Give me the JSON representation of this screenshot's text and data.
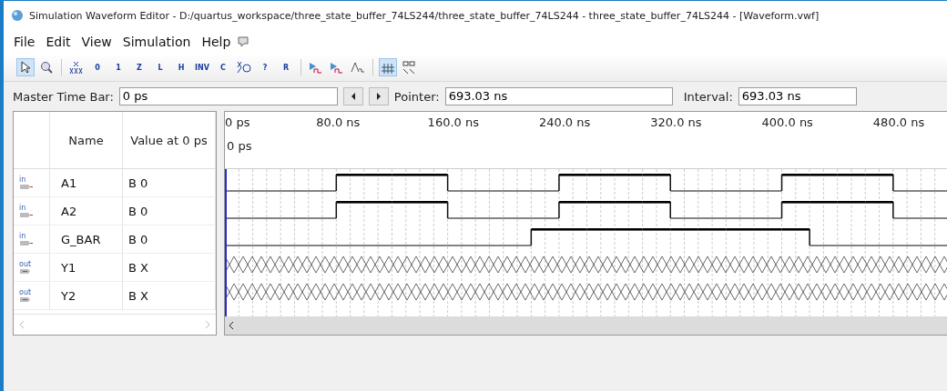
{
  "window": {
    "title": "Simulation Waveform Editor - D:/quartus_workspace/three_state_buffer_74LS244/three_state_buffer_74LS244 - three_state_buffer_74LS244 - [Waveform.vwf]"
  },
  "menu": [
    "File",
    "Edit",
    "View",
    "Simulation",
    "Help"
  ],
  "toolbar": [
    {
      "kind": "pointer",
      "selected": true
    },
    {
      "kind": "zoom",
      "selected": false
    },
    {
      "kind": "sep"
    },
    {
      "kind": "unknown",
      "selected": false
    },
    {
      "kind": "glyph",
      "glyph": "0",
      "selected": false
    },
    {
      "kind": "glyph",
      "glyph": "1",
      "selected": false
    },
    {
      "kind": "glyph",
      "glyph": "Z",
      "selected": false
    },
    {
      "kind": "glyph",
      "glyph": "L",
      "selected": false
    },
    {
      "kind": "glyph",
      "glyph": "H",
      "selected": false
    },
    {
      "kind": "glyph",
      "glyph": "INV",
      "selected": false
    },
    {
      "kind": "glyph",
      "glyph": "C",
      "selected": false
    },
    {
      "kind": "clock",
      "selected": false
    },
    {
      "kind": "glyph",
      "glyph": "?",
      "selected": false
    },
    {
      "kind": "glyph",
      "glyph": "R",
      "selected": false
    },
    {
      "kind": "sep"
    },
    {
      "kind": "sim",
      "selected": false
    },
    {
      "kind": "sim",
      "selected": false
    },
    {
      "kind": "wave",
      "selected": false
    },
    {
      "kind": "sep"
    },
    {
      "kind": "snap",
      "selected": true
    },
    {
      "kind": "grid",
      "selected": false
    }
  ],
  "time_bar": {
    "master_label": "Master Time Bar:",
    "master_value": "0 ps",
    "pointer_label": "Pointer:",
    "pointer_value": "693.03 ns",
    "interval_label": "Interval:",
    "interval_value": "693.03 ns"
  },
  "table": {
    "columns": [
      "Name",
      "Value at 0 ps"
    ],
    "rows": [
      {
        "direction": "in",
        "name": "A1",
        "value": "B 0",
        "unknown": false,
        "high": [
          false,
          false,
          false,
          false,
          true,
          true,
          true,
          true,
          false,
          false,
          false,
          false,
          true,
          true,
          true,
          true,
          false,
          false,
          false,
          false,
          true,
          true,
          true,
          true,
          false,
          false
        ]
      },
      {
        "direction": "in",
        "name": "A2",
        "value": "B 0",
        "unknown": false,
        "high": [
          false,
          false,
          false,
          false,
          true,
          true,
          true,
          true,
          false,
          false,
          false,
          false,
          true,
          true,
          true,
          true,
          false,
          false,
          false,
          false,
          true,
          true,
          true,
          true,
          false,
          false
        ]
      },
      {
        "direction": "in",
        "name": "G_BAR",
        "value": "B 0",
        "unknown": false,
        "high": [
          false,
          false,
          false,
          false,
          false,
          false,
          false,
          false,
          false,
          false,
          false,
          true,
          true,
          true,
          true,
          true,
          true,
          true,
          true,
          true,
          true,
          false,
          false,
          false,
          false,
          false
        ]
      },
      {
        "direction": "out",
        "name": "Y1",
        "value": "B X",
        "unknown": true
      },
      {
        "direction": "out",
        "name": "Y2",
        "value": "B X",
        "unknown": true
      }
    ]
  },
  "waveform": {
    "ruler": [
      "0 ps",
      "80.0 ns",
      "160.0 ns",
      "240.0 ns",
      "320.0 ns",
      "400.0 ns",
      "480.0 ns"
    ],
    "marker_label": "0 ps"
  }
}
